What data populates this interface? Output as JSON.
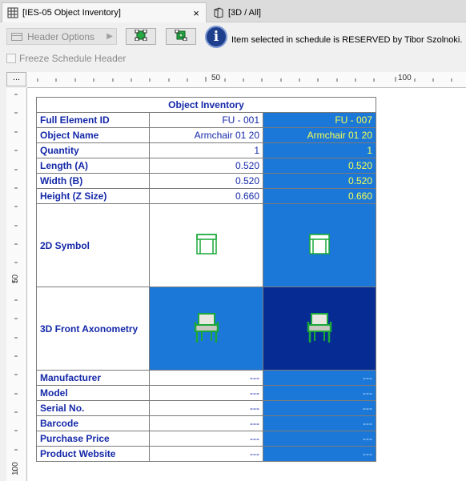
{
  "tabs": [
    {
      "label": "[IES-05 Object Inventory]",
      "icon": "schedule-icon",
      "close": "×"
    },
    {
      "label": "[3D / All]",
      "icon": "3d-window-icon"
    }
  ],
  "toolbar": {
    "header_options_label": "Header Options",
    "info_message": "Item selected in schedule is RESERVED by Tibor Szolnoki.",
    "freeze_label": "Freeze Schedule Header",
    "ruler_corner": "..."
  },
  "ruler": {
    "h_labels": [
      "50",
      "100"
    ],
    "v_labels": [
      "50",
      "100"
    ]
  },
  "schedule": {
    "title": "Object Inventory",
    "rows": [
      {
        "label": "Full Element ID",
        "c1": "FU - 001",
        "c2": "FU - 007"
      },
      {
        "label": "Object Name",
        "c1": "Armchair 01 20",
        "c2": "Armchair 01 20"
      },
      {
        "label": "Quantity",
        "c1": "1",
        "c2": "1"
      },
      {
        "label": "Length (A)",
        "c1": "0.520",
        "c2": "0.520"
      },
      {
        "label": "Width (B)",
        "c1": "0.520",
        "c2": "0.520"
      },
      {
        "label": "Height (Z Size)",
        "c1": "0.660",
        "c2": "0.660"
      }
    ],
    "symbol_label": "2D Symbol",
    "axo_label": "3D Front Axonometry",
    "bottom_rows": [
      {
        "label": "Manufacturer",
        "c1": "---",
        "c2": "---"
      },
      {
        "label": "Model",
        "c1": "---",
        "c2": "---"
      },
      {
        "label": "Serial No.",
        "c1": "---",
        "c2": "---"
      },
      {
        "label": "Barcode",
        "c1": "---",
        "c2": "---"
      },
      {
        "label": "Purchase Price",
        "c1": "---",
        "c2": "---"
      },
      {
        "label": "Product Website",
        "c1": "---",
        "c2": "---"
      }
    ]
  },
  "colors": {
    "accent": "#1c78d8",
    "selected_dark": "#062c94",
    "label_blue": "#1428a8",
    "highlight_text": "#f2ff55"
  }
}
